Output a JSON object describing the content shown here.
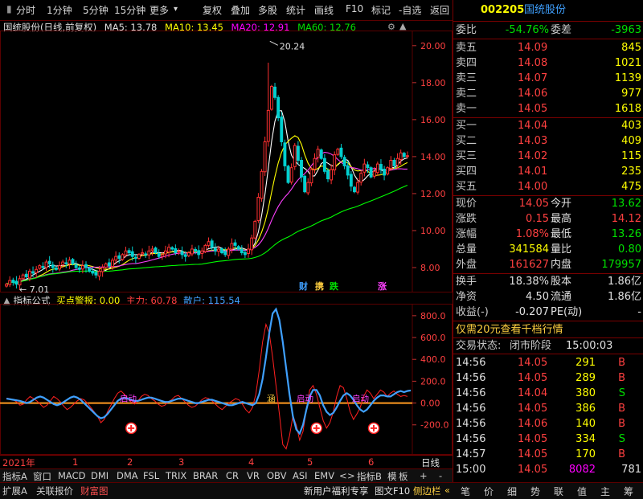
{
  "toolbar": {
    "left": [
      "分时",
      "1分钟",
      "5分钟",
      "15分钟",
      "更多"
    ],
    "right": [
      "复权",
      "叠加",
      "多股",
      "统计",
      "画线",
      "F10",
      "标记",
      "-自选",
      "返回"
    ],
    "more_arrow": "▾"
  },
  "chart_header": {
    "title": "国统股份(日线,前复权)",
    "ma5": "MA5: 13.78",
    "ma10": "MA10: 13.45",
    "ma20": "MA20: 12.91",
    "ma60": "MA60: 12.76"
  },
  "colors": {
    "up": "#ff3030",
    "down": "#00d0d0",
    "ma5": "#ffffff",
    "ma10": "#ffff00",
    "ma20": "#ff40ff",
    "ma60": "#00ff00",
    "grid": "#5a0000"
  },
  "chart_data": [
    {
      "type": "candlestick",
      "title": "国统股份(日线,前复权)",
      "y_ticks": [
        "20.00",
        "18.00",
        "16.00",
        "14.00",
        "12.00",
        "10.00",
        "8.00"
      ],
      "ylim": [
        7.0,
        20.6
      ],
      "annotations": {
        "high": "20.24",
        "low": "7.01"
      },
      "event_badges": [
        "财",
        "携",
        "跌",
        "涨"
      ],
      "legend": [
        "MA5: 13.78",
        "MA10: 13.45",
        "MA20: 12.91",
        "MA60: 12.76"
      ],
      "close": [
        7.1,
        7.3,
        7.2,
        7.1,
        7.4,
        7.6,
        7.5,
        7.8,
        7.7,
        7.9,
        8.1,
        8.0,
        8.3,
        8.2,
        8.0,
        7.9,
        8.1,
        8.3,
        8.2,
        8.4,
        8.2,
        8.0,
        7.9,
        8.1,
        8.0,
        7.8,
        7.7,
        7.6,
        7.8,
        8.0,
        8.2,
        8.1,
        8.4,
        8.6,
        8.5,
        8.7,
        8.9,
        8.8,
        8.6,
        8.5,
        8.7,
        8.8,
        8.7,
        8.9,
        9.0,
        8.8,
        8.6,
        8.7,
        8.9,
        9.1,
        9.0,
        8.8,
        8.9,
        8.7,
        8.6,
        8.8,
        9.0,
        8.9,
        8.7,
        8.9,
        9.2,
        9.4,
        9.1,
        8.9,
        9.0,
        8.8,
        8.7,
        9.0,
        9.3,
        9.2,
        9.0,
        8.8,
        8.7,
        9.0,
        9.6,
        10.5,
        11.8,
        13.2,
        14.8,
        16.5,
        17.8,
        17.2,
        16.1,
        14.8,
        13.5,
        12.6,
        13.4,
        14.6,
        13.8,
        12.9,
        12.1,
        12.6,
        13.3,
        13.9,
        14.4,
        13.9,
        13.2,
        12.8,
        13.3,
        14.1,
        14.4,
        14.0,
        13.5,
        13.0,
        12.4,
        12.1,
        12.6,
        13.1,
        13.6,
        13.4,
        12.9,
        13.2,
        13.6,
        13.3,
        13.0,
        13.4,
        13.8,
        13.5,
        13.9,
        14.2,
        14.0,
        14.05
      ],
      "ma60_end": 12.76
    },
    {
      "type": "line",
      "title": "指标公式",
      "series": [
        {
          "name": "买点警报",
          "value": "0.00"
        },
        {
          "name": "主力",
          "value": "60.78"
        },
        {
          "name": "散户",
          "value": "115.54"
        }
      ],
      "y_ticks": [
        "800.0",
        "600.0",
        "400.0",
        "200.0",
        "0.00",
        "-200.0"
      ],
      "ylim": [
        -430,
        880
      ],
      "zero_marks": [
        "启动",
        "涵",
        "启动",
        "启动"
      ],
      "main_force": [
        45,
        40,
        30,
        10,
        -20,
        -10,
        30,
        60,
        40,
        20,
        -10,
        -40,
        -20,
        20,
        60,
        40,
        10,
        -30,
        -60,
        -40,
        -10,
        20,
        40,
        30,
        0,
        -40,
        -80,
        -120,
        -180,
        -150,
        -80,
        -20,
        40,
        90,
        110,
        80,
        40,
        10,
        -10,
        20,
        60,
        80,
        70,
        40,
        20,
        -10,
        -30,
        -20,
        10,
        30,
        60,
        70,
        40,
        10,
        -20,
        -40,
        -30,
        0,
        30,
        50,
        40,
        20,
        -10,
        -40,
        -60,
        -30,
        0,
        20,
        40,
        30,
        -10,
        -60,
        -90,
        -40,
        80,
        300,
        560,
        720,
        640,
        420,
        160,
        -100,
        -380,
        -420,
        -300,
        -120,
        -200,
        -340,
        -260,
        -60,
        120,
        160,
        80,
        -40,
        -160,
        -230,
        -180,
        -80,
        60,
        160,
        140,
        40,
        -80,
        -150,
        -100,
        -40,
        60,
        120,
        90,
        40,
        80,
        120,
        100,
        60,
        90,
        110,
        80,
        60,
        70,
        60
      ],
      "retail": [
        40,
        35,
        30,
        25,
        20,
        10,
        0,
        10,
        30,
        50,
        60,
        50,
        30,
        10,
        -10,
        -20,
        -10,
        10,
        30,
        50,
        60,
        50,
        30,
        0,
        -30,
        -60,
        -90,
        -120,
        -140,
        -130,
        -100,
        -60,
        -20,
        20,
        40,
        50,
        40,
        30,
        20,
        20,
        30,
        40,
        50,
        50,
        40,
        30,
        20,
        10,
        10,
        20,
        30,
        40,
        40,
        30,
        20,
        10,
        0,
        0,
        10,
        20,
        30,
        30,
        20,
        10,
        0,
        -10,
        -20,
        -20,
        -10,
        0,
        10,
        0,
        -10,
        -20,
        0,
        80,
        220,
        420,
        640,
        820,
        860,
        760,
        560,
        320,
        80,
        -120,
        -240,
        -280,
        -200,
        -60,
        60,
        120,
        120,
        70,
        -20,
        -80,
        -110,
        -90,
        -40,
        20,
        70,
        90,
        70,
        30,
        -20,
        -60,
        -80,
        -60,
        -20,
        20,
        50,
        70,
        70,
        60,
        60,
        80,
        100,
        110,
        100,
        110,
        115
      ],
      "signals_x": [
        37,
        92,
        109
      ]
    }
  ],
  "time_axis": {
    "year": "2021年",
    "months": [
      "1",
      "2",
      "3",
      "4",
      "5",
      "6"
    ],
    "right_label": "日线"
  },
  "indicator_tabs": [
    "指标A",
    "窗口",
    "MACD",
    "DMI",
    "DMA",
    "FSL",
    "TRIX",
    "BRAR",
    "CR",
    "VR",
    "OBV",
    "ASI",
    "EMV",
    "<",
    ">",
    "指标B",
    "模",
    "板",
    "+",
    "-"
  ],
  "status_bar": {
    "left": [
      "扩展A",
      "关联报价",
      "财富图"
    ],
    "promo": "新用户福利专享",
    "f10": "图文F10",
    "side": "侧边栏",
    "side_arrow": "«",
    "right_tabs": [
      "笔",
      "价",
      "细",
      "势",
      "联",
      "值",
      "主",
      "筹"
    ]
  },
  "quote": {
    "code": "002205",
    "name": "国统股份",
    "weibi_label": "委比",
    "weibi": "-54.76%",
    "weicha_label": "委差",
    "weicha": "-3963",
    "asks": [
      {
        "label": "卖五",
        "price": "14.09",
        "vol": "845"
      },
      {
        "label": "卖四",
        "price": "14.08",
        "vol": "1021"
      },
      {
        "label": "卖三",
        "price": "14.07",
        "vol": "1139"
      },
      {
        "label": "卖二",
        "price": "14.06",
        "vol": "977"
      },
      {
        "label": "卖一",
        "price": "14.05",
        "vol": "1618"
      }
    ],
    "bids": [
      {
        "label": "买一",
        "price": "14.04",
        "vol": "403"
      },
      {
        "label": "买二",
        "price": "14.03",
        "vol": "409"
      },
      {
        "label": "买三",
        "price": "14.02",
        "vol": "115"
      },
      {
        "label": "买四",
        "price": "14.01",
        "vol": "235"
      },
      {
        "label": "买五",
        "price": "14.00",
        "vol": "475"
      }
    ],
    "stats": [
      {
        "l1": "现价",
        "v1": "14.05",
        "c1": "red",
        "l2": "今开",
        "v2": "13.62",
        "c2": "green"
      },
      {
        "l1": "涨跌",
        "v1": "0.15",
        "c1": "red",
        "l2": "最高",
        "v2": "14.12",
        "c2": "red"
      },
      {
        "l1": "涨幅",
        "v1": "1.08%",
        "c1": "red",
        "l2": "最低",
        "v2": "13.26",
        "c2": "green"
      },
      {
        "l1": "总量",
        "v1": "341584",
        "c1": "yellow",
        "l2": "量比",
        "v2": "0.80",
        "c2": "green"
      },
      {
        "l1": "外盘",
        "v1": "161627",
        "c1": "red",
        "l2": "内盘",
        "v2": "179957",
        "c2": "green"
      }
    ],
    "stats2": [
      {
        "l1": "换手",
        "v1": "18.38%",
        "l2": "股本",
        "v2": "1.86亿"
      },
      {
        "l1": "净资",
        "v1": "4.50",
        "l2": "流通",
        "v2": "1.86亿"
      },
      {
        "l1": "收益(-)",
        "v1": "-0.207",
        "l2": "PE(动)",
        "v2": "-"
      }
    ],
    "banner": "仅需20元查看千档行情",
    "trade_status_label": "交易状态:",
    "trade_status": "闭市阶段",
    "trade_time": "15:00:03",
    "ticks": [
      {
        "t": "14:56",
        "p": "14.05",
        "v": "291",
        "s": "B"
      },
      {
        "t": "14:56",
        "p": "14.05",
        "v": "289",
        "s": "B"
      },
      {
        "t": "14:56",
        "p": "14.04",
        "v": "380",
        "s": "S"
      },
      {
        "t": "14:56",
        "p": "14.05",
        "v": "386",
        "s": "B"
      },
      {
        "t": "14:56",
        "p": "14.06",
        "v": "140",
        "s": "B"
      },
      {
        "t": "14:56",
        "p": "14.05",
        "v": "334",
        "s": "S"
      },
      {
        "t": "14:57",
        "p": "14.05",
        "v": "170",
        "s": "B"
      },
      {
        "t": "15:00",
        "p": "14.05",
        "v": "8082",
        "s": "781"
      }
    ]
  }
}
